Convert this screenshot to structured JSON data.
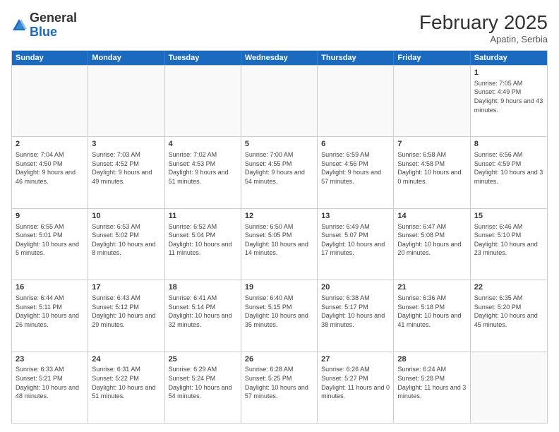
{
  "header": {
    "logo": {
      "general": "General",
      "blue": "Blue"
    },
    "title": "February 2025",
    "subtitle": "Apatin, Serbia"
  },
  "calendar": {
    "days": [
      "Sunday",
      "Monday",
      "Tuesday",
      "Wednesday",
      "Thursday",
      "Friday",
      "Saturday"
    ],
    "rows": [
      [
        {
          "day": "",
          "info": ""
        },
        {
          "day": "",
          "info": ""
        },
        {
          "day": "",
          "info": ""
        },
        {
          "day": "",
          "info": ""
        },
        {
          "day": "",
          "info": ""
        },
        {
          "day": "",
          "info": ""
        },
        {
          "day": "1",
          "info": "Sunrise: 7:05 AM\nSunset: 4:49 PM\nDaylight: 9 hours and 43 minutes."
        }
      ],
      [
        {
          "day": "2",
          "info": "Sunrise: 7:04 AM\nSunset: 4:50 PM\nDaylight: 9 hours and 46 minutes."
        },
        {
          "day": "3",
          "info": "Sunrise: 7:03 AM\nSunset: 4:52 PM\nDaylight: 9 hours and 49 minutes."
        },
        {
          "day": "4",
          "info": "Sunrise: 7:02 AM\nSunset: 4:53 PM\nDaylight: 9 hours and 51 minutes."
        },
        {
          "day": "5",
          "info": "Sunrise: 7:00 AM\nSunset: 4:55 PM\nDaylight: 9 hours and 54 minutes."
        },
        {
          "day": "6",
          "info": "Sunrise: 6:59 AM\nSunset: 4:56 PM\nDaylight: 9 hours and 57 minutes."
        },
        {
          "day": "7",
          "info": "Sunrise: 6:58 AM\nSunset: 4:58 PM\nDaylight: 10 hours and 0 minutes."
        },
        {
          "day": "8",
          "info": "Sunrise: 6:56 AM\nSunset: 4:59 PM\nDaylight: 10 hours and 3 minutes."
        }
      ],
      [
        {
          "day": "9",
          "info": "Sunrise: 6:55 AM\nSunset: 5:01 PM\nDaylight: 10 hours and 5 minutes."
        },
        {
          "day": "10",
          "info": "Sunrise: 6:53 AM\nSunset: 5:02 PM\nDaylight: 10 hours and 8 minutes."
        },
        {
          "day": "11",
          "info": "Sunrise: 6:52 AM\nSunset: 5:04 PM\nDaylight: 10 hours and 11 minutes."
        },
        {
          "day": "12",
          "info": "Sunrise: 6:50 AM\nSunset: 5:05 PM\nDaylight: 10 hours and 14 minutes."
        },
        {
          "day": "13",
          "info": "Sunrise: 6:49 AM\nSunset: 5:07 PM\nDaylight: 10 hours and 17 minutes."
        },
        {
          "day": "14",
          "info": "Sunrise: 6:47 AM\nSunset: 5:08 PM\nDaylight: 10 hours and 20 minutes."
        },
        {
          "day": "15",
          "info": "Sunrise: 6:46 AM\nSunset: 5:10 PM\nDaylight: 10 hours and 23 minutes."
        }
      ],
      [
        {
          "day": "16",
          "info": "Sunrise: 6:44 AM\nSunset: 5:11 PM\nDaylight: 10 hours and 26 minutes."
        },
        {
          "day": "17",
          "info": "Sunrise: 6:43 AM\nSunset: 5:12 PM\nDaylight: 10 hours and 29 minutes."
        },
        {
          "day": "18",
          "info": "Sunrise: 6:41 AM\nSunset: 5:14 PM\nDaylight: 10 hours and 32 minutes."
        },
        {
          "day": "19",
          "info": "Sunrise: 6:40 AM\nSunset: 5:15 PM\nDaylight: 10 hours and 35 minutes."
        },
        {
          "day": "20",
          "info": "Sunrise: 6:38 AM\nSunset: 5:17 PM\nDaylight: 10 hours and 38 minutes."
        },
        {
          "day": "21",
          "info": "Sunrise: 6:36 AM\nSunset: 5:18 PM\nDaylight: 10 hours and 41 minutes."
        },
        {
          "day": "22",
          "info": "Sunrise: 6:35 AM\nSunset: 5:20 PM\nDaylight: 10 hours and 45 minutes."
        }
      ],
      [
        {
          "day": "23",
          "info": "Sunrise: 6:33 AM\nSunset: 5:21 PM\nDaylight: 10 hours and 48 minutes."
        },
        {
          "day": "24",
          "info": "Sunrise: 6:31 AM\nSunset: 5:22 PM\nDaylight: 10 hours and 51 minutes."
        },
        {
          "day": "25",
          "info": "Sunrise: 6:29 AM\nSunset: 5:24 PM\nDaylight: 10 hours and 54 minutes."
        },
        {
          "day": "26",
          "info": "Sunrise: 6:28 AM\nSunset: 5:25 PM\nDaylight: 10 hours and 57 minutes."
        },
        {
          "day": "27",
          "info": "Sunrise: 6:26 AM\nSunset: 5:27 PM\nDaylight: 11 hours and 0 minutes."
        },
        {
          "day": "28",
          "info": "Sunrise: 6:24 AM\nSunset: 5:28 PM\nDaylight: 11 hours and 3 minutes."
        },
        {
          "day": "",
          "info": ""
        }
      ]
    ]
  }
}
